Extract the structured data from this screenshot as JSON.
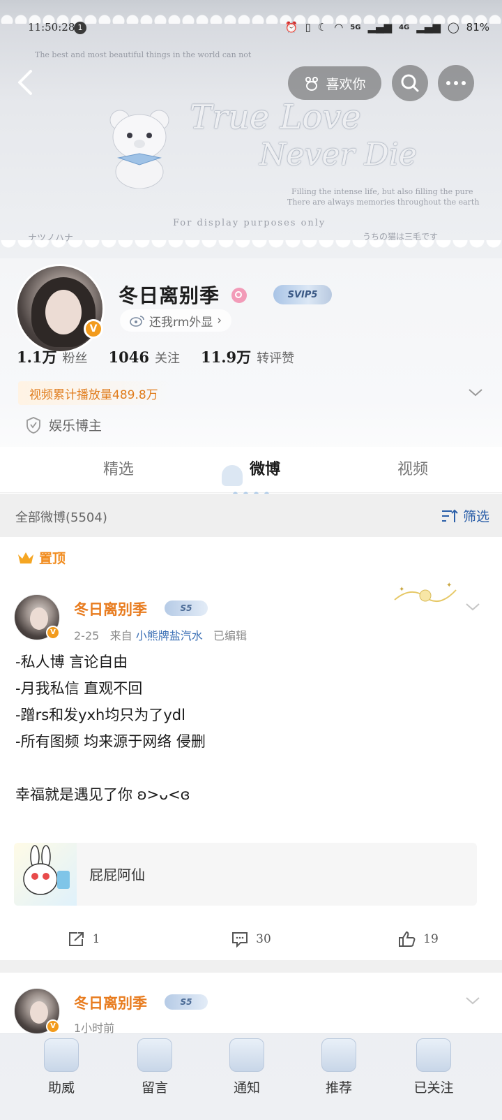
{
  "status_bar": {
    "time": "11:50:28",
    "notif_count": "1",
    "network": "5G",
    "network2": "4G",
    "battery": "81%"
  },
  "header": {
    "like_label": "喜欢你",
    "banner_lines": [
      "The best and most beautiful things in the world can not",
      "True Love",
      "Never Die",
      "Filling the intense life, but also filling the pure",
      "There are always memories throughout the earth",
      "For display purposes only",
      "ナツノハナ",
      "うちの猫は三毛です"
    ]
  },
  "profile": {
    "name": "冬日离别季",
    "svip": "SVIP5",
    "subtitle": "还我rm外显",
    "stats": [
      {
        "num": "1.1万",
        "label": "粉丝"
      },
      {
        "num": "1046",
        "label": "关注"
      },
      {
        "num": "11.9万",
        "label": "转评赞"
      }
    ],
    "play_tag": "视频累计播放量489.8万",
    "verify": "娱乐博主"
  },
  "tabs": [
    "精选",
    "微博",
    "视频"
  ],
  "feed": {
    "title": "全部微博(5504)",
    "filter": "筛选"
  },
  "posts": [
    {
      "pin": "置顶",
      "name": "冬日离别季",
      "badge": "S5",
      "date": "2-25",
      "from": "来自",
      "source": "小熊牌盐汽水",
      "edited": "已编辑",
      "lines": [
        "-私人博 言论自由",
        "-月我私信 直观不回",
        "-蹭rs和发yxh均只为了ydl",
        "-所有图频 均来源于网络 侵删",
        "",
        "幸福就是遇见了你 ʚ>ᴗ<ɞ"
      ],
      "card_title": "屁屁阿仙",
      "reposts": "1",
      "comments": "30",
      "likes": "19"
    },
    {
      "name": "冬日离别季",
      "badge": "S5",
      "time": "1小时前"
    }
  ],
  "bottom_nav": [
    "助威",
    "留言",
    "通知",
    "推荐",
    "已关注"
  ]
}
